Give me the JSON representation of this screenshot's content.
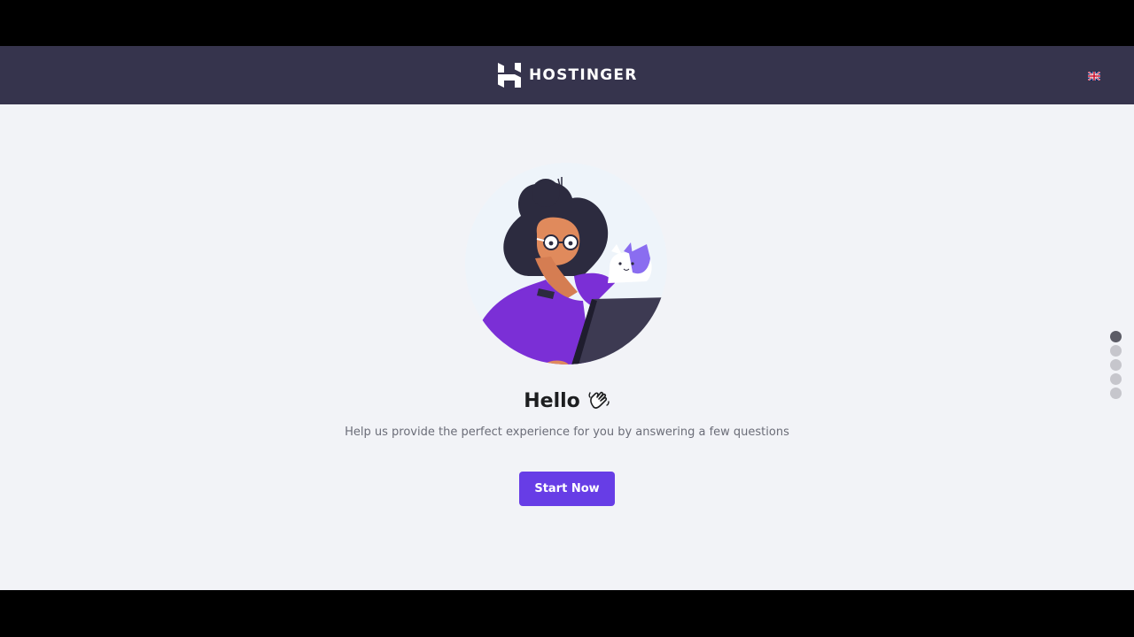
{
  "header": {
    "brand": "HOSTINGER",
    "language_icon": "uk-flag-icon"
  },
  "main": {
    "title": "Hello",
    "wave_icon": "waving-hand-icon",
    "subtitle": "Help us provide the perfect experience for you by answering a few questions",
    "start_button": "Start Now",
    "illustration": "woman-with-laptop-and-cat-illustration"
  },
  "pagination": {
    "total_steps": 5,
    "active_step": 1
  },
  "colors": {
    "header_bg": "#36344d",
    "page_bg": "#f2f3f7",
    "accent": "#673de6",
    "letterbox": "#000000"
  }
}
